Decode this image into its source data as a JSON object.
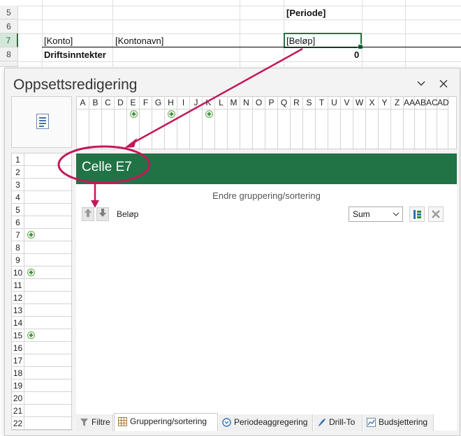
{
  "sheet": {
    "rows": [
      "5",
      "6",
      "7",
      "8"
    ],
    "header_label": "[Periode]",
    "row7": {
      "konto": "[Konto]",
      "kontonavn": "[Kontonavn]",
      "belop": "[Beløp]"
    },
    "row8": {
      "label": "Driftsinntekter",
      "value": "0"
    }
  },
  "dialog": {
    "title": "Oppsettsredigering",
    "columns": [
      "A",
      "B",
      "C",
      "D",
      "E",
      "F",
      "G",
      "H",
      "I",
      "J",
      "K",
      "L",
      "M",
      "N",
      "O",
      "P",
      "Q",
      "R",
      "S",
      "T",
      "U",
      "V",
      "W",
      "X",
      "Y",
      "Z",
      "AA",
      "AB",
      "AC",
      "AD"
    ],
    "rows": [
      "1",
      "2",
      "3",
      "4",
      "5",
      "6",
      "7",
      "8",
      "9",
      "10",
      "11",
      "12",
      "13",
      "14",
      "15",
      "16",
      "17",
      "18",
      "19",
      "20",
      "21",
      "22"
    ],
    "cell_header": "Celle E7",
    "subtitle": "Endre gruppering/sortering",
    "field_label": "Beløp",
    "aggregate": "Sum",
    "tabs": [
      "Filtre",
      "Gruppering/sortering",
      "Periodeaggregering",
      "Drill-To",
      "Budsjettering"
    ]
  },
  "colors": {
    "accent_green": "#217346",
    "annotation_magenta": "#c2185b"
  }
}
